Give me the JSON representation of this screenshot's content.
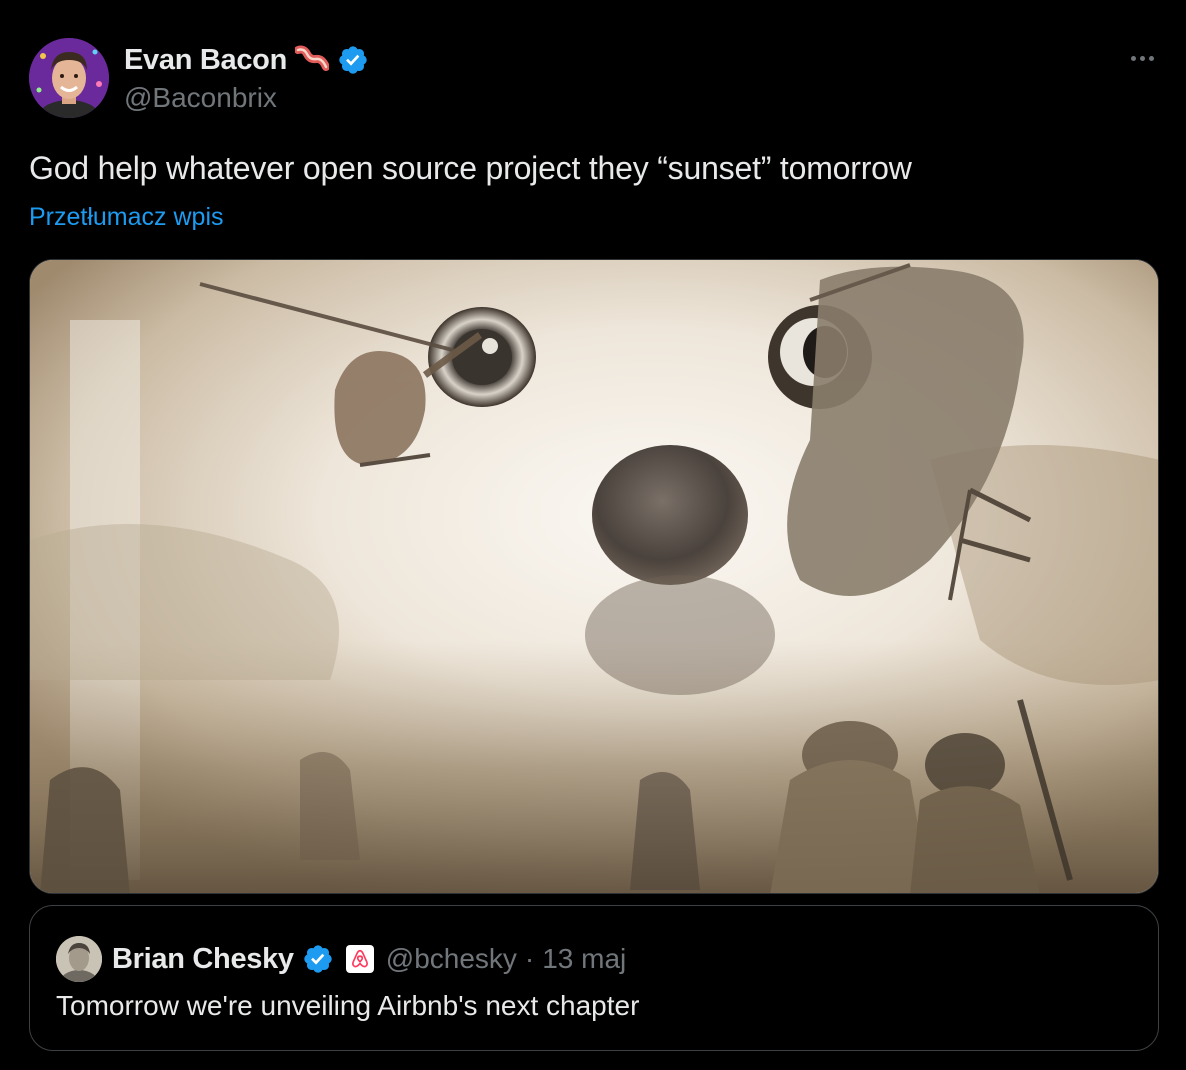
{
  "author": {
    "display_name": "Evan Bacon",
    "handle": "@Baconbrix",
    "name_emoji_icon": "bacon-icon",
    "verified_icon": "verified-badge-icon"
  },
  "tweet": {
    "text": "God help whatever open source project they “sunset” tomorrow",
    "translate_label": "Przetłumacz wpis",
    "more_icon": "more-options-icon"
  },
  "media": {
    "image_icon": "meme-dog-helicopters-image"
  },
  "quoted_tweet": {
    "display_name": "Brian Chesky",
    "handle": "@bchesky",
    "separator": "·",
    "date": "13 maj",
    "text": "Tomorrow we're unveiling Airbnb's next chapter",
    "affiliation_icon": "airbnb-logo-icon"
  },
  "colors": {
    "background": "#000000",
    "text_primary": "#e7e9ea",
    "text_secondary": "#71767b",
    "link": "#1d9bf0",
    "border": "#2f3336",
    "verified": "#1d9bf0",
    "airbnb": "#ff385c"
  }
}
